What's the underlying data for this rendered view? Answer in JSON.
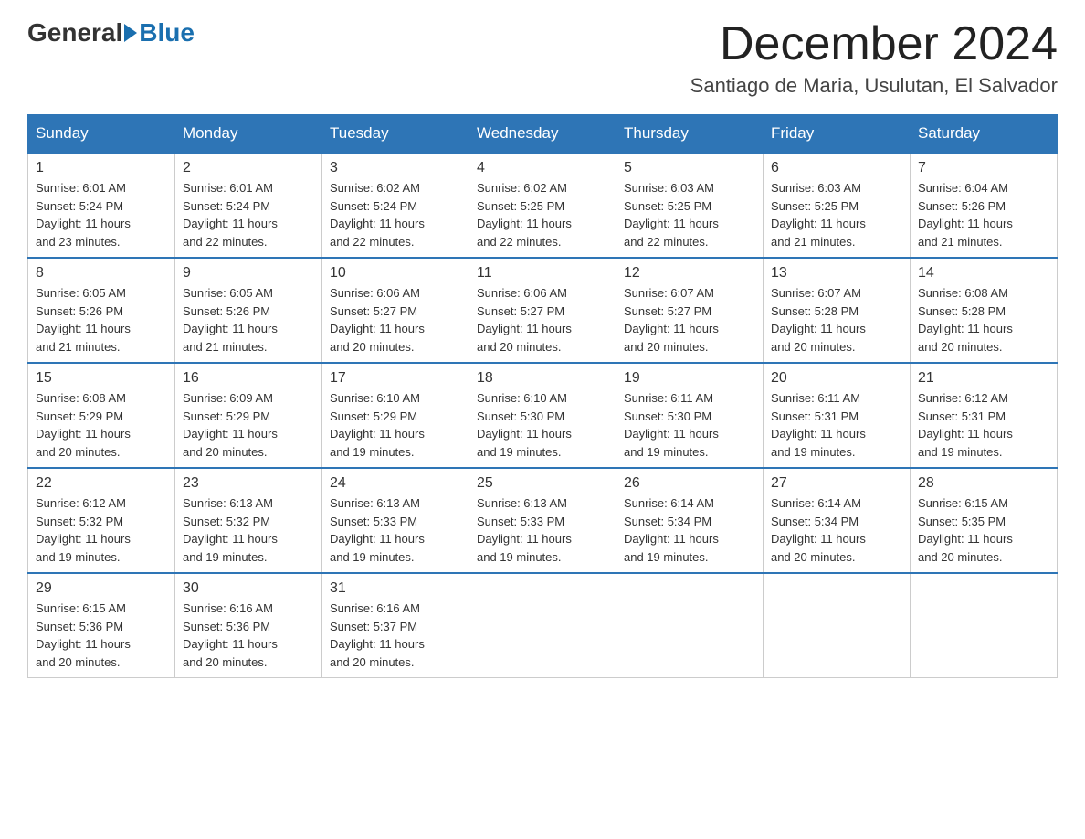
{
  "header": {
    "logo_general": "General",
    "logo_blue": "Blue",
    "month_title": "December 2024",
    "location": "Santiago de Maria, Usulutan, El Salvador"
  },
  "days_of_week": [
    "Sunday",
    "Monday",
    "Tuesday",
    "Wednesday",
    "Thursday",
    "Friday",
    "Saturday"
  ],
  "weeks": [
    [
      {
        "day": "1",
        "sunrise": "6:01 AM",
        "sunset": "5:24 PM",
        "daylight": "11 hours and 23 minutes."
      },
      {
        "day": "2",
        "sunrise": "6:01 AM",
        "sunset": "5:24 PM",
        "daylight": "11 hours and 22 minutes."
      },
      {
        "day": "3",
        "sunrise": "6:02 AM",
        "sunset": "5:24 PM",
        "daylight": "11 hours and 22 minutes."
      },
      {
        "day": "4",
        "sunrise": "6:02 AM",
        "sunset": "5:25 PM",
        "daylight": "11 hours and 22 minutes."
      },
      {
        "day": "5",
        "sunrise": "6:03 AM",
        "sunset": "5:25 PM",
        "daylight": "11 hours and 22 minutes."
      },
      {
        "day": "6",
        "sunrise": "6:03 AM",
        "sunset": "5:25 PM",
        "daylight": "11 hours and 21 minutes."
      },
      {
        "day": "7",
        "sunrise": "6:04 AM",
        "sunset": "5:26 PM",
        "daylight": "11 hours and 21 minutes."
      }
    ],
    [
      {
        "day": "8",
        "sunrise": "6:05 AM",
        "sunset": "5:26 PM",
        "daylight": "11 hours and 21 minutes."
      },
      {
        "day": "9",
        "sunrise": "6:05 AM",
        "sunset": "5:26 PM",
        "daylight": "11 hours and 21 minutes."
      },
      {
        "day": "10",
        "sunrise": "6:06 AM",
        "sunset": "5:27 PM",
        "daylight": "11 hours and 20 minutes."
      },
      {
        "day": "11",
        "sunrise": "6:06 AM",
        "sunset": "5:27 PM",
        "daylight": "11 hours and 20 minutes."
      },
      {
        "day": "12",
        "sunrise": "6:07 AM",
        "sunset": "5:27 PM",
        "daylight": "11 hours and 20 minutes."
      },
      {
        "day": "13",
        "sunrise": "6:07 AM",
        "sunset": "5:28 PM",
        "daylight": "11 hours and 20 minutes."
      },
      {
        "day": "14",
        "sunrise": "6:08 AM",
        "sunset": "5:28 PM",
        "daylight": "11 hours and 20 minutes."
      }
    ],
    [
      {
        "day": "15",
        "sunrise": "6:08 AM",
        "sunset": "5:29 PM",
        "daylight": "11 hours and 20 minutes."
      },
      {
        "day": "16",
        "sunrise": "6:09 AM",
        "sunset": "5:29 PM",
        "daylight": "11 hours and 20 minutes."
      },
      {
        "day": "17",
        "sunrise": "6:10 AM",
        "sunset": "5:29 PM",
        "daylight": "11 hours and 19 minutes."
      },
      {
        "day": "18",
        "sunrise": "6:10 AM",
        "sunset": "5:30 PM",
        "daylight": "11 hours and 19 minutes."
      },
      {
        "day": "19",
        "sunrise": "6:11 AM",
        "sunset": "5:30 PM",
        "daylight": "11 hours and 19 minutes."
      },
      {
        "day": "20",
        "sunrise": "6:11 AM",
        "sunset": "5:31 PM",
        "daylight": "11 hours and 19 minutes."
      },
      {
        "day": "21",
        "sunrise": "6:12 AM",
        "sunset": "5:31 PM",
        "daylight": "11 hours and 19 minutes."
      }
    ],
    [
      {
        "day": "22",
        "sunrise": "6:12 AM",
        "sunset": "5:32 PM",
        "daylight": "11 hours and 19 minutes."
      },
      {
        "day": "23",
        "sunrise": "6:13 AM",
        "sunset": "5:32 PM",
        "daylight": "11 hours and 19 minutes."
      },
      {
        "day": "24",
        "sunrise": "6:13 AM",
        "sunset": "5:33 PM",
        "daylight": "11 hours and 19 minutes."
      },
      {
        "day": "25",
        "sunrise": "6:13 AM",
        "sunset": "5:33 PM",
        "daylight": "11 hours and 19 minutes."
      },
      {
        "day": "26",
        "sunrise": "6:14 AM",
        "sunset": "5:34 PM",
        "daylight": "11 hours and 19 minutes."
      },
      {
        "day": "27",
        "sunrise": "6:14 AM",
        "sunset": "5:34 PM",
        "daylight": "11 hours and 20 minutes."
      },
      {
        "day": "28",
        "sunrise": "6:15 AM",
        "sunset": "5:35 PM",
        "daylight": "11 hours and 20 minutes."
      }
    ],
    [
      {
        "day": "29",
        "sunrise": "6:15 AM",
        "sunset": "5:36 PM",
        "daylight": "11 hours and 20 minutes."
      },
      {
        "day": "30",
        "sunrise": "6:16 AM",
        "sunset": "5:36 PM",
        "daylight": "11 hours and 20 minutes."
      },
      {
        "day": "31",
        "sunrise": "6:16 AM",
        "sunset": "5:37 PM",
        "daylight": "11 hours and 20 minutes."
      },
      null,
      null,
      null,
      null
    ]
  ],
  "labels": {
    "sunrise": "Sunrise:",
    "sunset": "Sunset:",
    "daylight": "Daylight:"
  }
}
